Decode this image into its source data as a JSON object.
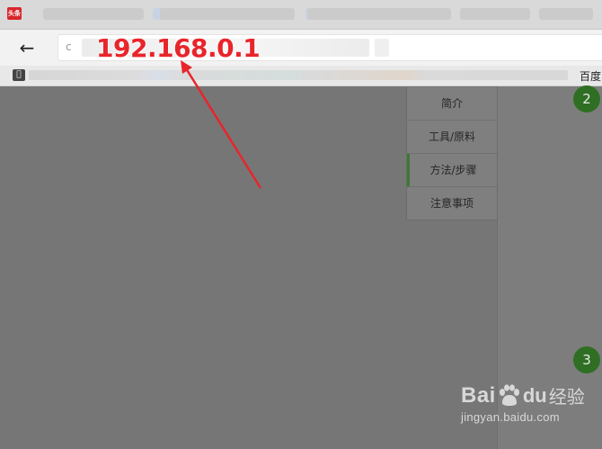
{
  "browser": {
    "app_logo_text": "头条",
    "address_bar": {
      "url_text": "192.168.0.1",
      "leading_glyph": "c"
    },
    "back_icon": "←",
    "bookmarks": {
      "apple_icon": "",
      "baidu_label": "百度"
    }
  },
  "page": {
    "toc": [
      {
        "label": "简介"
      },
      {
        "label": "工具/原料"
      },
      {
        "label": "方法/步骤"
      },
      {
        "label": "注意事项"
      }
    ],
    "step_badges": [
      "2",
      "3"
    ]
  },
  "watermark": {
    "brand_left": "Bai",
    "brand_right": "du",
    "brand_cn": "经验",
    "url": "jingyan.baidu.com"
  },
  "colors": {
    "annotation_red": "#e8252b",
    "step_green": "#2f6f23"
  }
}
